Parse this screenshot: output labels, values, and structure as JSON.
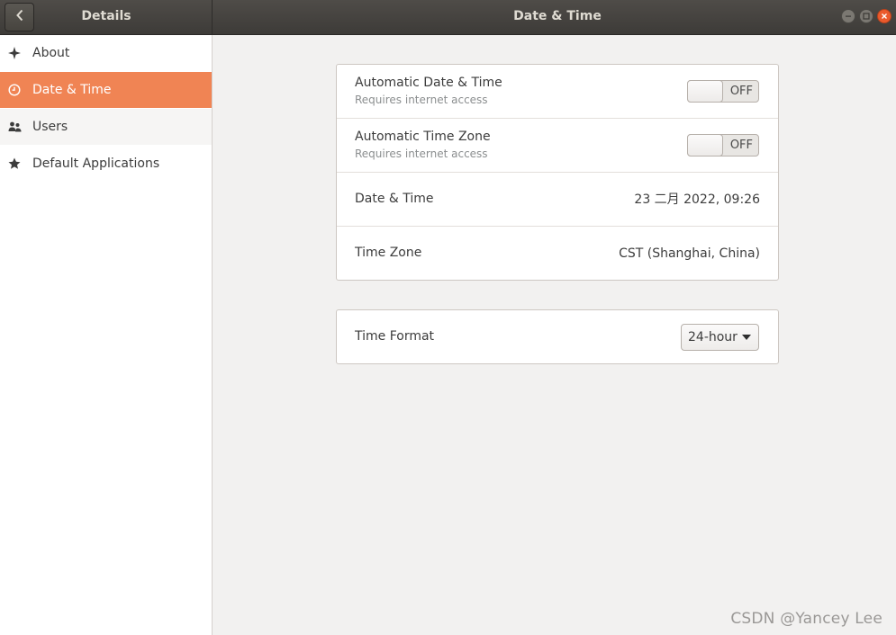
{
  "header": {
    "left_title": "Details",
    "title": "Date & Time",
    "back_icon": "chevron-left-icon"
  },
  "window_controls": [
    "minimize",
    "maximize",
    "close"
  ],
  "sidebar": {
    "items": [
      {
        "label": "About",
        "icon": "sparkle-icon"
      },
      {
        "label": "Date & Time",
        "icon": "clock-icon",
        "active": true
      },
      {
        "label": "Users",
        "icon": "users-icon"
      },
      {
        "label": "Default Applications",
        "icon": "star-icon"
      }
    ]
  },
  "panel_main": {
    "auto_datetime": {
      "title": "Automatic Date & Time",
      "subtitle": "Requires internet access",
      "state": "OFF"
    },
    "auto_timezone": {
      "title": "Automatic Time Zone",
      "subtitle": "Requires internet access",
      "state": "OFF"
    },
    "datetime": {
      "title": "Date & Time",
      "value": "23 二月 2022, 09:26"
    },
    "timezone": {
      "title": "Time Zone",
      "value": "CST (Shanghai, China)"
    }
  },
  "panel_format": {
    "time_format": {
      "title": "Time Format",
      "selected": "24-hour"
    }
  },
  "watermark": "CSDN @Yancey Lee",
  "colors": {
    "accent": "#f08454",
    "header": "#3d3b38",
    "close": "#ea5a2c"
  }
}
